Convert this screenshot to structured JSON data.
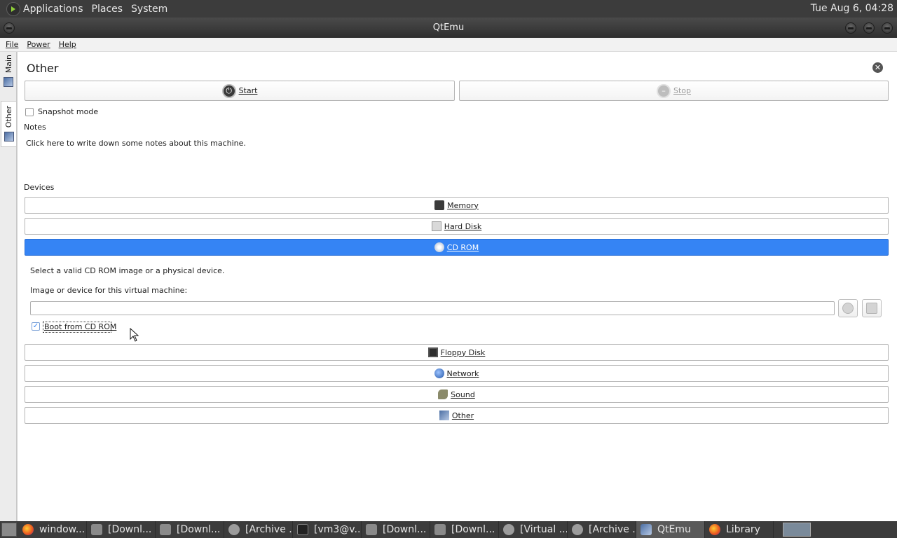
{
  "top_panel": {
    "menus": [
      "Applications",
      "Places",
      "System"
    ],
    "clock": "Tue Aug  6, 04:28"
  },
  "window": {
    "title": "QtEmu"
  },
  "menubar": {
    "items": [
      "File",
      "Power",
      "Help"
    ]
  },
  "side_tabs": [
    {
      "label": "Main",
      "active": false
    },
    {
      "label": "Other",
      "active": true
    }
  ],
  "machine": {
    "name": "Other",
    "start_label": "Start",
    "stop_label": "Stop",
    "snapshot_label": "Snapshot mode",
    "snapshot_checked": false,
    "notes_header": "Notes",
    "notes_placeholder": "Click here to write down some notes about this machine.",
    "devices_header": "Devices"
  },
  "devices": {
    "memory": "Memory",
    "hard_disk": "Hard Disk",
    "cd_rom": "CD ROM",
    "floppy": "Floppy Disk",
    "network": "Network",
    "sound": "Sound",
    "other": "Other"
  },
  "cdrom_panel": {
    "description": "Select a valid CD ROM image or a physical device.",
    "image_label": "Image or device for this virtual machine:",
    "image_value": "",
    "boot_label": "Boot from CD ROM",
    "boot_checked": true
  },
  "taskbar": {
    "tasks": [
      {
        "label": "window...",
        "icon": "firefox-icon"
      },
      {
        "label": "[Downl...",
        "icon": "folder-icon"
      },
      {
        "label": "[Downl...",
        "icon": "folder-icon"
      },
      {
        "label": "[Archive ...",
        "icon": "archive-icon"
      },
      {
        "label": "[vm3@v...",
        "icon": "terminal-icon"
      },
      {
        "label": "[Downl...",
        "icon": "folder-icon"
      },
      {
        "label": "[Downl...",
        "icon": "folder-icon"
      },
      {
        "label": "[Virtual ...",
        "icon": "virtualbox-icon"
      },
      {
        "label": "[Archive ...",
        "icon": "archive-icon"
      },
      {
        "label": "QtEmu",
        "icon": "qtemu-icon",
        "active": true
      },
      {
        "label": "Library",
        "icon": "firefox-icon"
      }
    ]
  },
  "colors": {
    "accent": "#3584f4",
    "panel": "#3c3c3c"
  }
}
